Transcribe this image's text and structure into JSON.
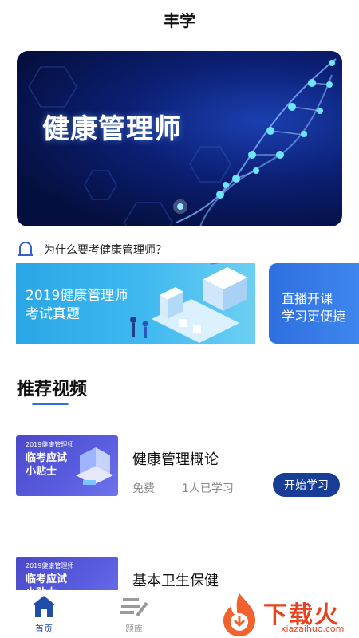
{
  "app": {
    "title": "丰学"
  },
  "hero": {
    "title": "健康管理师"
  },
  "notice": {
    "text": "为什么要考健康管理师？"
  },
  "promos": [
    {
      "line1": "2019健康管理师",
      "line2": "考试真题"
    },
    {
      "line1": "直播开课",
      "line2": "学习更便捷"
    }
  ],
  "section": {
    "title": "推荐视频"
  },
  "courses": [
    {
      "thumb_small": "2019健康管理师",
      "thumb_big": "临考应试小贴士",
      "title": "健康管理概论",
      "price": "免费",
      "learners": "1人已学习",
      "button": "开始学习"
    },
    {
      "thumb_small": "2019健康管理师",
      "thumb_big": "临考应试小贴士",
      "title": "基本卫生保健"
    }
  ],
  "tabbar": {
    "items": [
      {
        "label": "首页",
        "icon": "home-icon",
        "active": true
      },
      {
        "label": "题库",
        "icon": "question-bank-icon",
        "active": false
      }
    ]
  },
  "watermark": {
    "text": "下载火",
    "domain": "xiazaihuo.com"
  },
  "colors": {
    "accent": "#2f6fe0",
    "button": "#173d97",
    "watermark": "#e8431f",
    "tab_active": "#1f4ea8",
    "tab_inactive": "#9a9a9a"
  }
}
